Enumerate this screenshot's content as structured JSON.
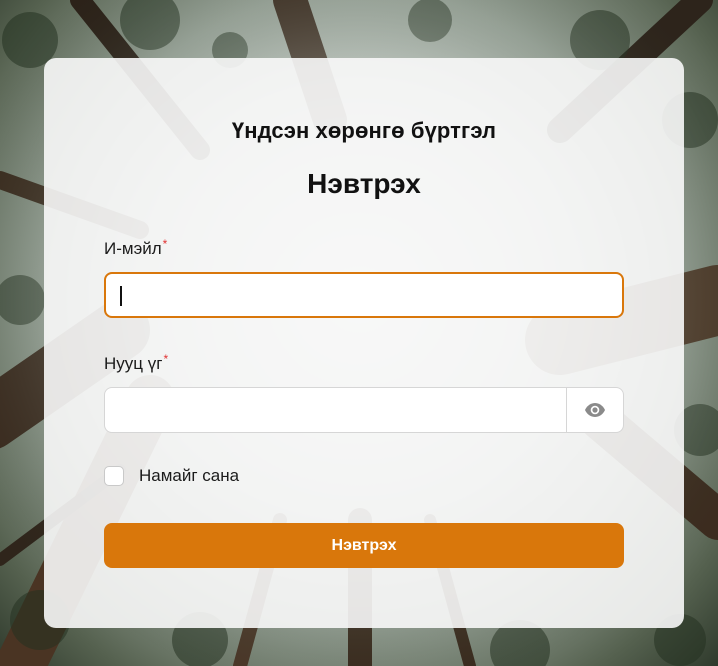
{
  "app_title": "Үндсэн хөрөнгө бүртгэл",
  "page_title": "Нэвтрэх",
  "form": {
    "email": {
      "label": "И-мэйл",
      "required_mark": "*",
      "value": ""
    },
    "password": {
      "label": "Нууц үг",
      "required_mark": "*",
      "value": "",
      "toggle_icon": "eye-icon"
    },
    "remember": {
      "label": "Намайг сана",
      "checked": false
    },
    "submit_label": "Нэвтрэх"
  },
  "colors": {
    "accent": "#d9770b",
    "required": "#e03131"
  }
}
